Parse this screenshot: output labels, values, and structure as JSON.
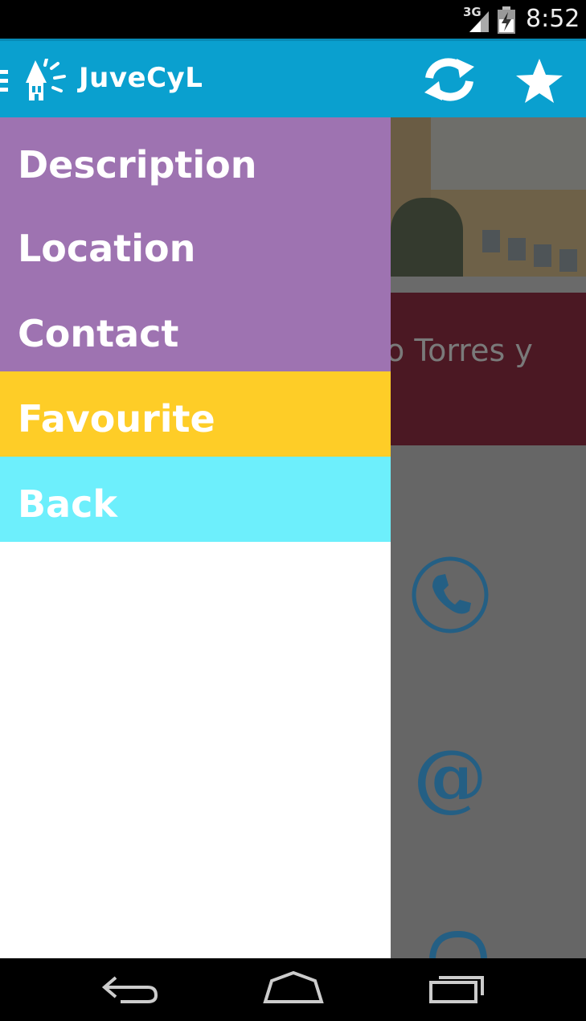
{
  "status_bar": {
    "network": "3G",
    "time": "8:52",
    "icons": [
      "signal-icon",
      "battery-icon"
    ]
  },
  "action_bar": {
    "app_title": "JuveCyL",
    "icons": [
      "drawer-indicator-icon",
      "juvecyl-logo-icon",
      "refresh-icon",
      "star-icon"
    ],
    "color": "#0aa0cf"
  },
  "content": {
    "title_partial": "o Torres y",
    "icons": [
      "phone-icon",
      "at-icon"
    ]
  },
  "drawer": {
    "items": [
      {
        "label": "Description",
        "color": "#9e73b1"
      },
      {
        "label": "Location",
        "color": "#9e73b1"
      },
      {
        "label": "Contact",
        "color": "#9e73b1"
      },
      {
        "label": "Favourite",
        "color": "#fecd27"
      },
      {
        "label": "Back",
        "color": "#6deffc"
      }
    ]
  },
  "nav_bar": {
    "icons": [
      "back-icon",
      "home-icon",
      "recents-icon"
    ]
  }
}
